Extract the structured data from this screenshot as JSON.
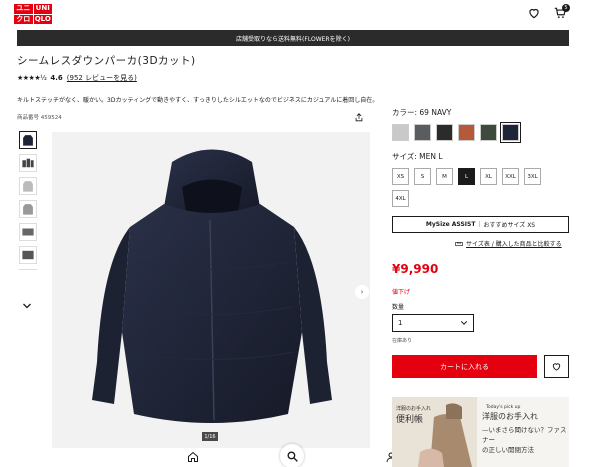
{
  "header": {
    "logo": {
      "line1_left": "ユニ",
      "line1_right": "UNI",
      "line2_left": "クロ",
      "line2_right": "QLO"
    },
    "cart_count": "5",
    "icons": [
      "heart-icon",
      "cart-icon"
    ]
  },
  "banner": {
    "text": "店舗受取りなら送料無料(FLOWERを除く)"
  },
  "product": {
    "title": "シームレスダウンパーカ(3Dカット)",
    "rating": {
      "stars": "★★★★½",
      "score": "4.6",
      "reviews": "(952 レビューを見る)"
    },
    "description": "キルトステッチがなく、暖かい。3Dカッティングで動きやすく、すっきりしたシルエットなのでビジネスにカジュアルに着回し自在。",
    "code": "商品番号 459524",
    "image_counter": "1/16"
  },
  "color": {
    "label": "カラー: 69 NAVY",
    "swatches": [
      "#c9c9c9",
      "#5a5d60",
      "#2b2b2b",
      "#b5593a",
      "#3d4a3c",
      "#1f2538"
    ],
    "selected_index": 5
  },
  "size": {
    "label": "サイズ:  MEN L",
    "options": [
      "XS",
      "S",
      "M",
      "L",
      "XL",
      "XXL",
      "3XL",
      "4XL"
    ],
    "selected": "L"
  },
  "mysize": {
    "left": "MySize ASSIST",
    "right": "おすすめサイズ XS"
  },
  "size_chart_link": "サイズ表 / 購入した商品と比較する",
  "price": {
    "amount": "¥9,990",
    "tag": "値下げ"
  },
  "quantity": {
    "label": "数量",
    "value": "1"
  },
  "stock": "在庫あり",
  "add_to_cart": "カートに入れる",
  "promo": {
    "tag": "Today's pick up",
    "title": "洋服のお手入れ",
    "subtitle_line1": "—いまさら聞けない？ファスナー",
    "subtitle_line2": "の正しい開閉方法",
    "image_caption_top": "洋服のお手入れ",
    "image_caption_main": "便利帳"
  },
  "colors": {
    "accent": "#e5000f",
    "dark": "#1b1b1b"
  }
}
